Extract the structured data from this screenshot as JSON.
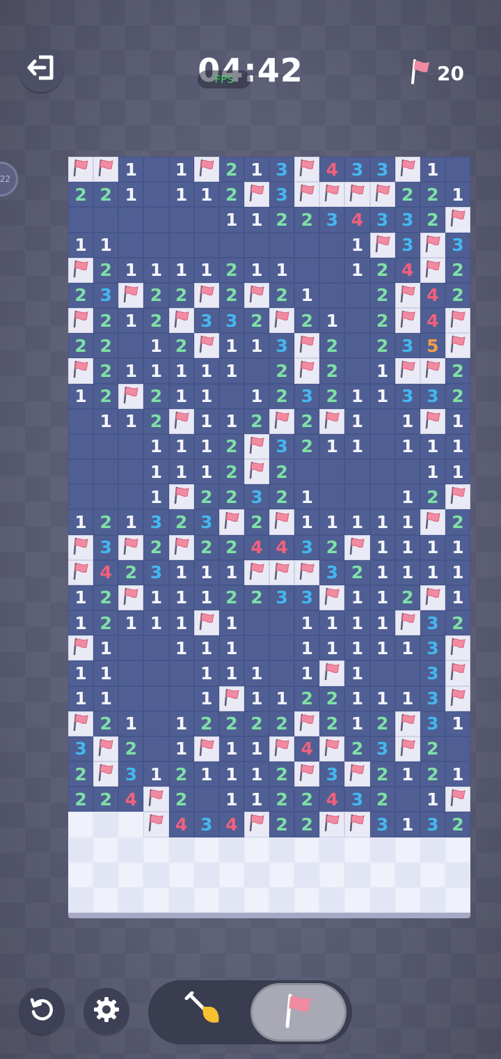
{
  "header": {
    "timer": "04:42",
    "fps_label": "FPS",
    "flag_count": "20",
    "side_badge": "22"
  },
  "icons": {
    "exit": "exit-icon",
    "flag": "flag-icon",
    "restart": "restart-icon",
    "settings": "gear-icon",
    "dig": "shovel-icon",
    "flag_mode": "flag-mode-icon"
  },
  "colors": {
    "number_1": "#f4f4fb",
    "number_2": "#7fe0a6",
    "number_3": "#44b7ef",
    "number_4": "#f2607c",
    "number_5": "#f2a04a",
    "flag": "#f08ba2",
    "open_cell": "#4f5f93",
    "covered_cell": "#eff1fb"
  },
  "board": {
    "cols": 16,
    "legend": "F = flagged, 0 = revealed empty, 1-5 = revealed number, # = unrevealed",
    "rows": [
      [
        "F",
        "F",
        "1",
        "0",
        "1",
        "F",
        "2",
        "1",
        "3",
        "F",
        "4",
        "3",
        "3",
        "F",
        "1",
        "0"
      ],
      [
        "2",
        "2",
        "1",
        "0",
        "1",
        "1",
        "2",
        "F",
        "3",
        "F",
        "F",
        "F",
        "F",
        "2",
        "2",
        "1"
      ],
      [
        "0",
        "0",
        "0",
        "0",
        "0",
        "0",
        "1",
        "1",
        "2",
        "2",
        "3",
        "4",
        "3",
        "3",
        "2",
        "F"
      ],
      [
        "1",
        "1",
        "0",
        "0",
        "0",
        "0",
        "0",
        "0",
        "0",
        "0",
        "0",
        "1",
        "F",
        "3",
        "F",
        "3"
      ],
      [
        "F",
        "2",
        "1",
        "1",
        "1",
        "1",
        "2",
        "1",
        "1",
        "0",
        "0",
        "1",
        "2",
        "4",
        "F",
        "2"
      ],
      [
        "2",
        "3",
        "F",
        "2",
        "2",
        "F",
        "2",
        "F",
        "2",
        "1",
        "0",
        "0",
        "2",
        "F",
        "4",
        "2"
      ],
      [
        "F",
        "2",
        "1",
        "2",
        "F",
        "3",
        "3",
        "2",
        "F",
        "2",
        "1",
        "0",
        "2",
        "F",
        "4",
        "F"
      ],
      [
        "2",
        "2",
        "0",
        "1",
        "2",
        "F",
        "1",
        "1",
        "3",
        "F",
        "2",
        "0",
        "2",
        "3",
        "5",
        "F"
      ],
      [
        "F",
        "2",
        "1",
        "1",
        "1",
        "1",
        "1",
        "0",
        "2",
        "F",
        "2",
        "0",
        "1",
        "F",
        "F",
        "2"
      ],
      [
        "1",
        "2",
        "F",
        "2",
        "1",
        "1",
        "0",
        "1",
        "2",
        "3",
        "2",
        "1",
        "1",
        "3",
        "3",
        "2"
      ],
      [
        "0",
        "1",
        "1",
        "2",
        "F",
        "1",
        "1",
        "2",
        "F",
        "2",
        "F",
        "1",
        "0",
        "1",
        "F",
        "1"
      ],
      [
        "0",
        "0",
        "0",
        "1",
        "1",
        "1",
        "2",
        "F",
        "3",
        "2",
        "1",
        "1",
        "0",
        "1",
        "1",
        "1"
      ],
      [
        "0",
        "0",
        "0",
        "1",
        "1",
        "1",
        "2",
        "F",
        "2",
        "0",
        "0",
        "0",
        "0",
        "0",
        "1",
        "1"
      ],
      [
        "0",
        "0",
        "0",
        "1",
        "F",
        "2",
        "2",
        "3",
        "2",
        "1",
        "0",
        "0",
        "0",
        "1",
        "2",
        "F"
      ],
      [
        "1",
        "2",
        "1",
        "3",
        "2",
        "3",
        "F",
        "2",
        "F",
        "1",
        "1",
        "1",
        "1",
        "1",
        "F",
        "2"
      ],
      [
        "F",
        "3",
        "F",
        "2",
        "F",
        "2",
        "2",
        "4",
        "4",
        "3",
        "2",
        "F",
        "1",
        "1",
        "1",
        "1"
      ],
      [
        "F",
        "4",
        "2",
        "3",
        "1",
        "1",
        "1",
        "F",
        "F",
        "F",
        "3",
        "2",
        "1",
        "1",
        "1",
        "1"
      ],
      [
        "1",
        "2",
        "F",
        "1",
        "1",
        "1",
        "2",
        "2",
        "3",
        "3",
        "F",
        "1",
        "1",
        "2",
        "F",
        "1"
      ],
      [
        "1",
        "2",
        "1",
        "1",
        "1",
        "F",
        "1",
        "0",
        "0",
        "1",
        "1",
        "1",
        "1",
        "F",
        "3",
        "2"
      ],
      [
        "F",
        "1",
        "0",
        "0",
        "1",
        "1",
        "1",
        "0",
        "0",
        "1",
        "1",
        "1",
        "1",
        "1",
        "3",
        "F"
      ],
      [
        "1",
        "1",
        "0",
        "0",
        "0",
        "1",
        "1",
        "1",
        "0",
        "1",
        "F",
        "1",
        "0",
        "0",
        "3",
        "F"
      ],
      [
        "1",
        "1",
        "0",
        "0",
        "0",
        "1",
        "F",
        "1",
        "1",
        "2",
        "2",
        "1",
        "1",
        "1",
        "3",
        "F"
      ],
      [
        "F",
        "2",
        "1",
        "0",
        "1",
        "2",
        "2",
        "2",
        "2",
        "F",
        "2",
        "1",
        "2",
        "F",
        "3",
        "1"
      ],
      [
        "3",
        "F",
        "2",
        "0",
        "1",
        "F",
        "1",
        "1",
        "F",
        "4",
        "F",
        "2",
        "3",
        "F",
        "2",
        "0"
      ],
      [
        "2",
        "F",
        "3",
        "1",
        "2",
        "1",
        "1",
        "1",
        "2",
        "F",
        "3",
        "F",
        "2",
        "1",
        "2",
        "1"
      ],
      [
        "2",
        "2",
        "4",
        "F",
        "2",
        "0",
        "1",
        "1",
        "2",
        "2",
        "4",
        "3",
        "2",
        "0",
        "1",
        "F"
      ],
      [
        "#",
        "#",
        "#",
        "F",
        "4",
        "3",
        "4",
        "F",
        "2",
        "2",
        "F",
        "F",
        "3",
        "1",
        "3",
        "2"
      ],
      [
        "#",
        "#",
        "#",
        "#",
        "#",
        "#",
        "#",
        "#",
        "#",
        "#",
        "#",
        "#",
        "#",
        "#",
        "#",
        "#"
      ],
      [
        "#",
        "#",
        "#",
        "#",
        "#",
        "#",
        "#",
        "#",
        "#",
        "#",
        "#",
        "#",
        "#",
        "#",
        "#",
        "#"
      ],
      [
        "#",
        "#",
        "#",
        "#",
        "#",
        "#",
        "#",
        "#",
        "#",
        "#",
        "#",
        "#",
        "#",
        "#",
        "#",
        "#"
      ]
    ]
  },
  "controls": {
    "active_mode": "flag"
  }
}
